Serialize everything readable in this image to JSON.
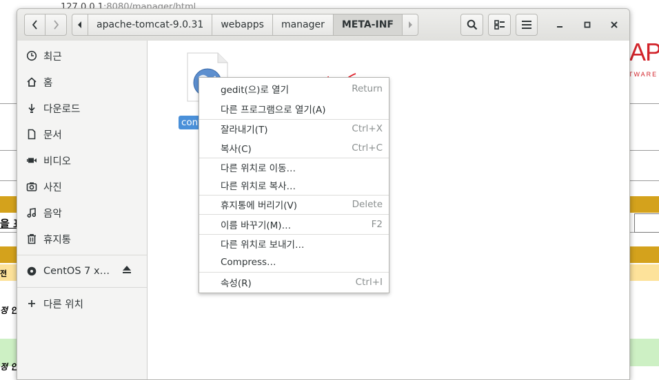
{
  "browser_bg": {
    "url_host": "127.0.0.1",
    "url_rest": ":8080/manager/html",
    "logo_text": "APA",
    "logo_sub": "TWARE",
    "row_text_1": "을 표",
    "row_text_2": "전",
    "row_text_3": "정 인",
    "row_text_4": "정 인"
  },
  "headerbar": {
    "breadcrumbs": [
      {
        "label": "apache-tomcat-9.0.31"
      },
      {
        "label": "webapps"
      },
      {
        "label": "manager"
      },
      {
        "label": "META-INF"
      }
    ],
    "icons": {
      "back": "chevron-left-icon",
      "forward": "chevron-right-icon",
      "search": "search-icon",
      "view": "list-view-icon",
      "menu": "hamburger-menu-icon",
      "minimize": "minimize-icon",
      "maximize": "maximize-icon",
      "close": "close-icon"
    }
  },
  "sidebar": {
    "items": [
      {
        "label": "최근",
        "icon": "clock-icon"
      },
      {
        "label": "홈",
        "icon": "home-icon"
      },
      {
        "label": "다운로드",
        "icon": "download-icon"
      },
      {
        "label": "문서",
        "icon": "document-icon"
      },
      {
        "label": "비디오",
        "icon": "video-icon"
      },
      {
        "label": "사진",
        "icon": "camera-icon"
      },
      {
        "label": "음악",
        "icon": "music-icon"
      },
      {
        "label": "휴지통",
        "icon": "trash-icon"
      }
    ],
    "devices": [
      {
        "label": "CentOS 7 x…",
        "icon": "disc-icon"
      }
    ],
    "other": {
      "label": "다른 위치",
      "icon": "plus-icon"
    }
  },
  "content": {
    "file": {
      "label": "context.xml",
      "visible_label": "cont"
    }
  },
  "context_menu": {
    "items": [
      {
        "label": "gedit(으)로 열기",
        "accel": "Return"
      },
      {
        "label": "다른 프로그램으로 열기(A)",
        "accel": ""
      },
      {
        "label": "잘라내기(T)",
        "accel": "Ctrl+X"
      },
      {
        "label": "복사(C)",
        "accel": "Ctrl+C"
      },
      {
        "label": "다른 위치로 이동…",
        "accel": ""
      },
      {
        "label": "다른 위치로 복사…",
        "accel": ""
      },
      {
        "label": "휴지통에 버리기(V)",
        "accel": "Delete"
      },
      {
        "label": "이름 바꾸기(M)…",
        "accel": "F2"
      },
      {
        "label": "다른 위치로 보내기…",
        "accel": ""
      },
      {
        "label": "Compress…",
        "accel": ""
      },
      {
        "label": "속성(R)",
        "accel": "Ctrl+I"
      }
    ]
  },
  "colors": {
    "selection": "#4a90d9",
    "annotation": "#e0202a",
    "gold_row": "#d4a21c",
    "light_gold_row": "#fde29a",
    "green_row": "#cdf0c4"
  }
}
